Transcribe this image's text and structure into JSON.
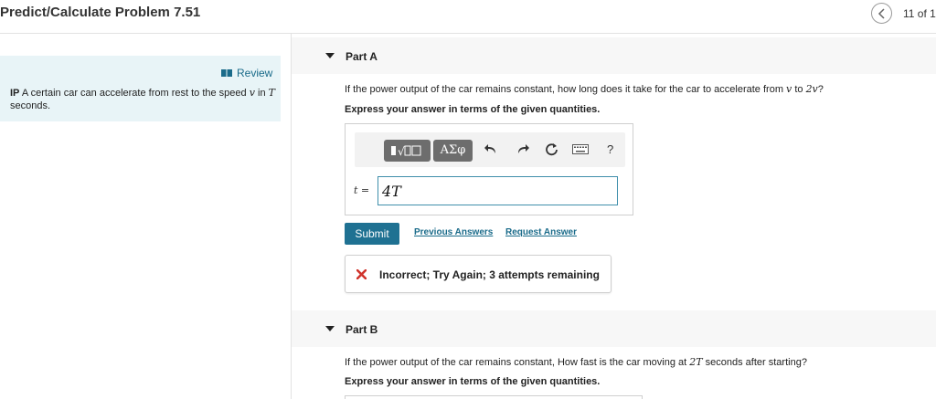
{
  "header": {
    "title": "Predict/Calculate Problem 7.51",
    "nav_count": "11 of 1"
  },
  "intro": {
    "review_label": "Review",
    "problem": {
      "prefix": "IP",
      "text_1": " A certain car can accelerate from rest to the speed ",
      "var_v": "v",
      "text_2": " in ",
      "var_T": "T",
      "text_3": " seconds."
    }
  },
  "part_a": {
    "label": "Part A",
    "question_1": "If the power output of the car remains constant, how long does it take for the car to accelerate from ",
    "var_v": "v",
    "question_2": " to ",
    "var_2v": "2v",
    "question_3": "?",
    "instruction": "Express your answer in terms of the given quantities.",
    "toolbar": {
      "templates_icon": "templates-icon",
      "symbols_label": "ΑΣφ",
      "undo_icon": "undo-icon",
      "redo_icon": "redo-icon",
      "reset_icon": "reset-icon",
      "keyboard_icon": "keyboard-icon",
      "help_label": "?"
    },
    "answer_var": "t =",
    "answer_value": "4T",
    "submit_label": "Submit",
    "previous_answers_label": "Previous Answers",
    "request_answer_label": "Request Answer",
    "feedback": "Incorrect; Try Again; 3 attempts remaining",
    "feedback_color": "#d0342c"
  },
  "part_b": {
    "label": "Part B",
    "question_1": "If the power output of the car remains constant, How fast is the car moving at ",
    "var_2T": "2T",
    "question_2": " seconds after starting?",
    "instruction": "Express your answer in terms of the given quantities."
  },
  "colors": {
    "accent": "#1f7192",
    "link": "#1a6b8a",
    "intro_bg": "#e8f4f7"
  }
}
